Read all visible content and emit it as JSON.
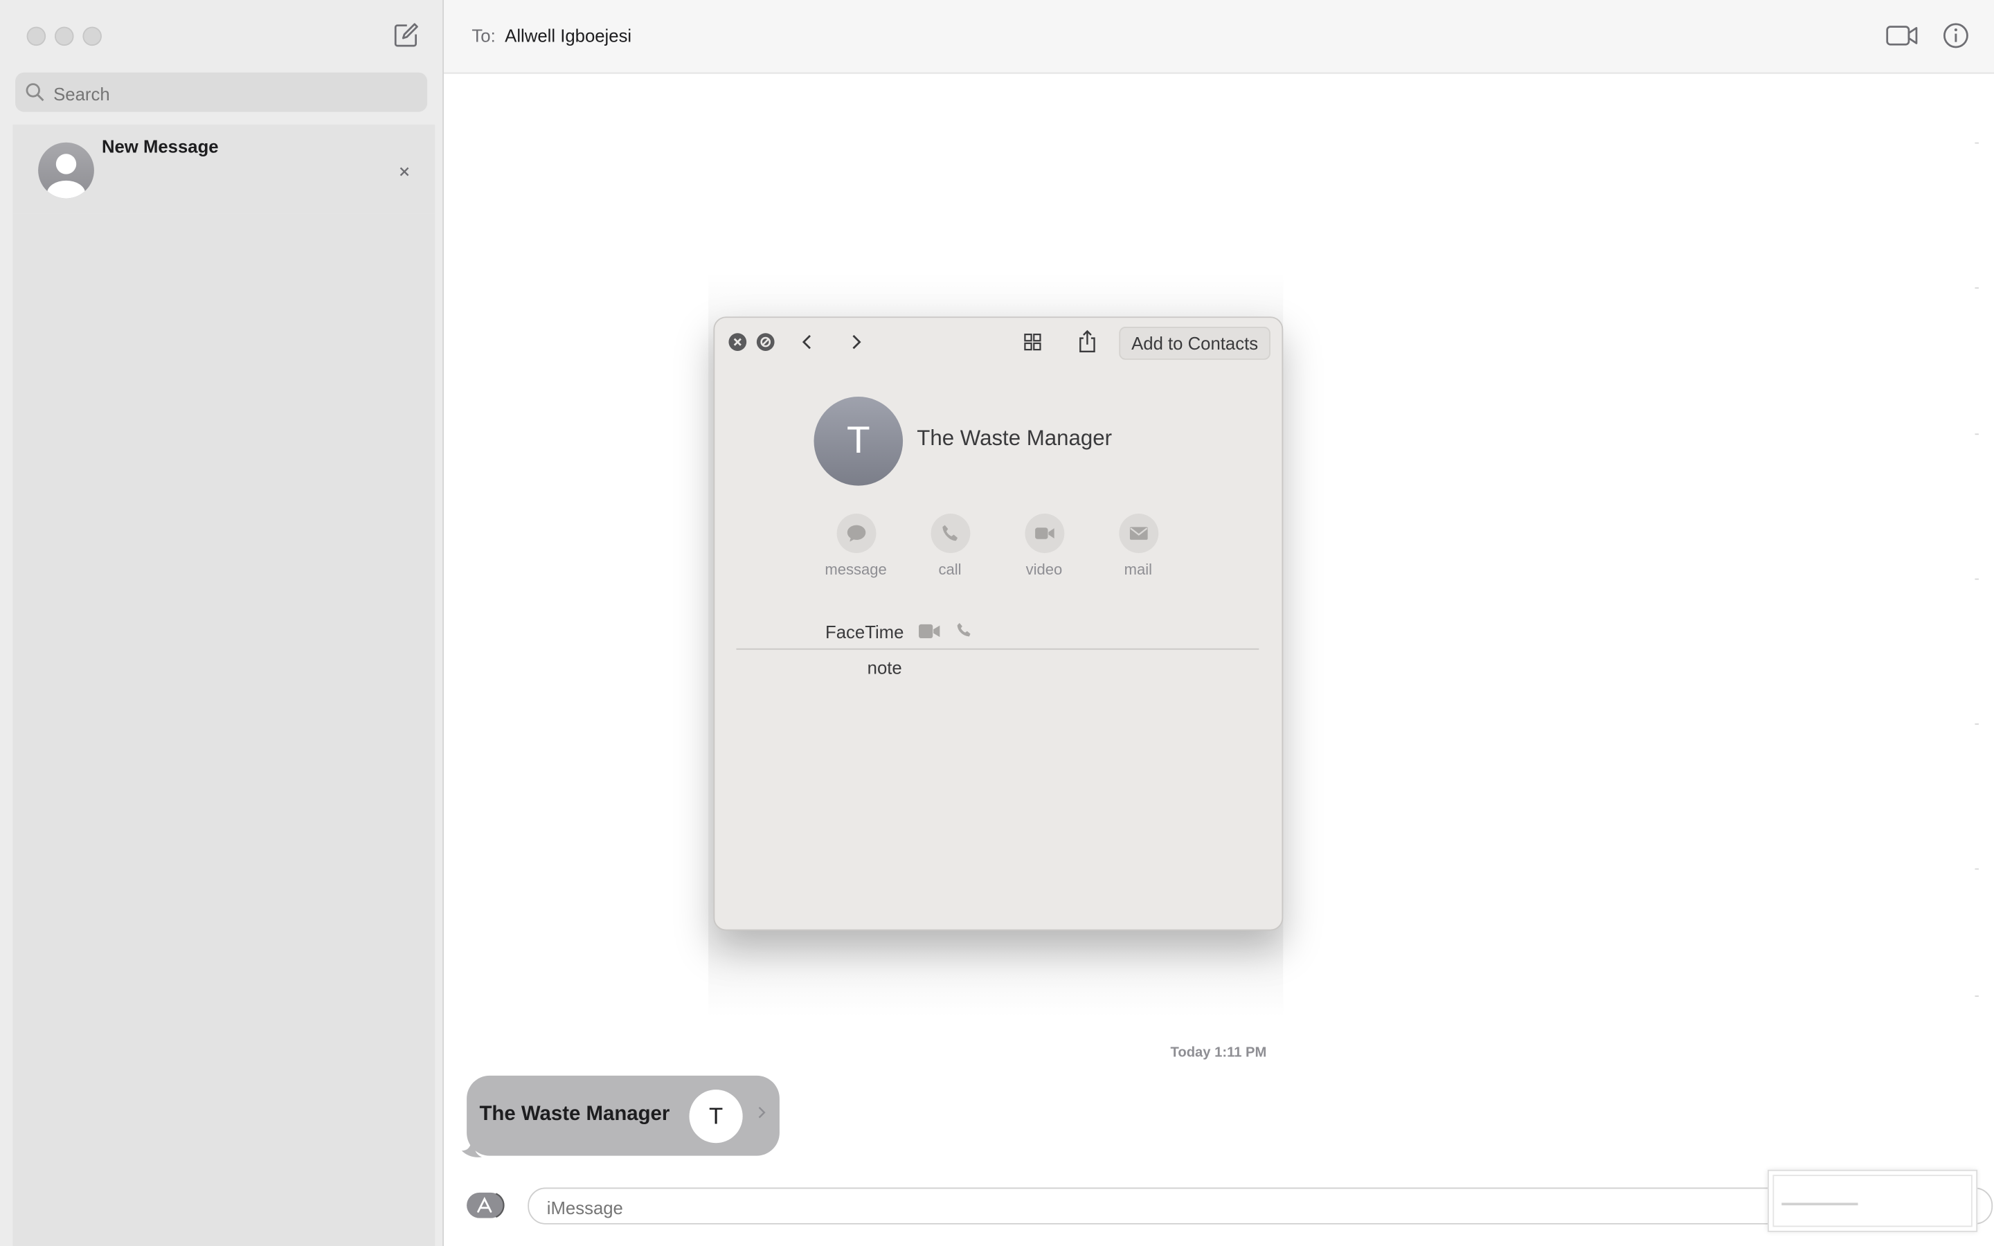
{
  "sidebar": {
    "search_placeholder": "Search",
    "conversation": {
      "title": "New Message"
    }
  },
  "header": {
    "to_label": "To:",
    "to_name": "Allwell Igboejesi"
  },
  "thread": {
    "timestamp": "Today 1:11 PM",
    "bubble": {
      "name": "The Waste Manager",
      "initial": "T"
    }
  },
  "composer": {
    "placeholder": "iMessage"
  },
  "contact_card": {
    "add_button": "Add to Contacts",
    "initial": "T",
    "name": "The Waste Manager",
    "actions": [
      {
        "label": "message",
        "icon": "message-icon"
      },
      {
        "label": "call",
        "icon": "phone-icon"
      },
      {
        "label": "video",
        "icon": "video-icon"
      },
      {
        "label": "mail",
        "icon": "mail-icon"
      }
    ],
    "facetime_label": "FaceTime",
    "note_label": "note"
  },
  "colors": {
    "sidebar_bg": "#ececec",
    "bubble_gray": "#b7b7b9",
    "card_bg": "#ebe9e7"
  }
}
